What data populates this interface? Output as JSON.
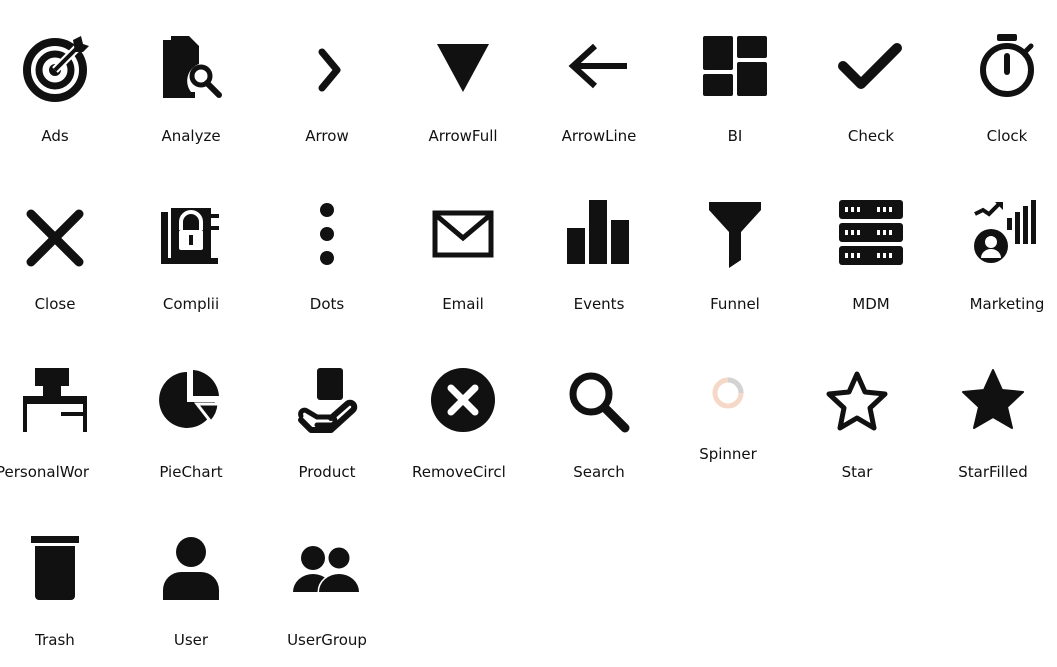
{
  "icons": [
    {
      "label": "Ads",
      "icon": "target-bullseye-icon"
    },
    {
      "label": "Analyze",
      "icon": "document-search-icon"
    },
    {
      "label": "Arrow",
      "icon": "chevron-right-icon"
    },
    {
      "label": "ArrowFull",
      "icon": "triangle-down-icon"
    },
    {
      "label": "ArrowLine",
      "icon": "arrow-left-icon"
    },
    {
      "label": "BI",
      "icon": "dashboard-icon"
    },
    {
      "label": "Check",
      "icon": "check-icon"
    },
    {
      "label": "Clock",
      "icon": "stopwatch-icon"
    },
    {
      "label": "Close",
      "icon": "close-x-icon"
    },
    {
      "label": "Complii",
      "icon": "compliance-lock-icon"
    },
    {
      "label": "Dots",
      "icon": "vertical-dots-icon"
    },
    {
      "label": "Email",
      "icon": "envelope-icon"
    },
    {
      "label": "Events",
      "icon": "bar-chart-icon"
    },
    {
      "label": "Funnel",
      "icon": "funnel-icon"
    },
    {
      "label": "MDM",
      "icon": "server-icon"
    },
    {
      "label": "Marketing",
      "icon": "marketing-icon"
    },
    {
      "label": "PersonalWor",
      "icon": "desk-workspace-icon"
    },
    {
      "label": "PieChart",
      "icon": "pie-chart-icon"
    },
    {
      "label": "Product",
      "icon": "hand-holding-product-icon"
    },
    {
      "label": "RemoveCircl",
      "icon": "remove-circle-icon"
    },
    {
      "label": "Search",
      "icon": "magnifier-icon"
    },
    {
      "label": "Spinner",
      "icon": "spinner-icon"
    },
    {
      "label": "Star",
      "icon": "star-outline-icon"
    },
    {
      "label": "StarFilled",
      "icon": "star-filled-icon"
    },
    {
      "label": "Trash",
      "icon": "trash-icon"
    },
    {
      "label": "User",
      "icon": "user-icon"
    },
    {
      "label": "UserGroup",
      "icon": "user-group-icon"
    }
  ],
  "colors": {
    "icon": "#111111",
    "spinner_track": "#f6d8c8",
    "spinner_arc": "#d3d3d3"
  }
}
